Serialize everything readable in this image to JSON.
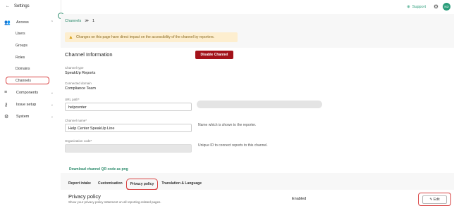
{
  "sidebar": {
    "back_label": "Settings",
    "items": [
      {
        "label": "Access",
        "chev": "⌃"
      },
      {
        "label": "Components",
        "chev": "⌄"
      },
      {
        "label": "Issue setup",
        "chev": "⌄"
      },
      {
        "label": "System",
        "chev": "⌄"
      }
    ],
    "sub": [
      "Users",
      "Groups",
      "Roles",
      "Domains",
      "Channels"
    ]
  },
  "topbar": {
    "support": "Support",
    "avatar": "KD"
  },
  "breadcrumb": {
    "root": "Channels",
    "sep": "≫",
    "current": "1"
  },
  "warning": "Changes on this page have direct impact on the accessibility of the channel by reporters.",
  "channel": {
    "heading": "Channel Information",
    "disable_label": "Disable Channel",
    "type_label": "Channel type",
    "type_value": "SpeakUp Reports",
    "domain_label": "Connected domain",
    "domain_value": "Compliance Team",
    "url_label": "URL path*",
    "url_value": "helpcenter",
    "name_label": "Channel name*",
    "name_value": "Help Center SpeakUp Line",
    "name_hint": "Name which is shown to the reporter.",
    "org_label": "Organization code*",
    "org_hint": "Unique ID to connect reports to this channel.",
    "qr_link": "Download channel QR code as png"
  },
  "tabs": [
    "Report intake",
    "Customisation",
    "Privacy policy",
    "Translation & Language"
  ],
  "privacy": {
    "title": "Privacy policy",
    "desc": "Show your privacy policy statement on all reporting-related pages.",
    "status": "Enabled",
    "edit_label": "Edit"
  }
}
